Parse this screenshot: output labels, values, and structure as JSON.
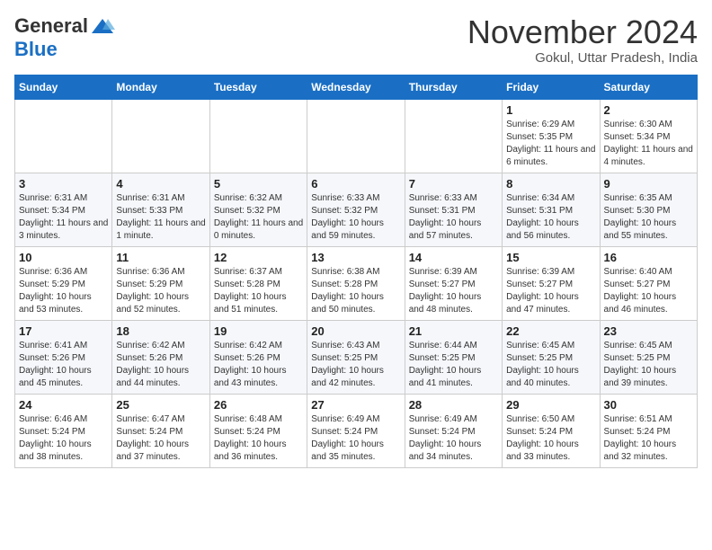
{
  "logo": {
    "line1": "General",
    "line2": "Blue"
  },
  "title": "November 2024",
  "location": "Gokul, Uttar Pradesh, India",
  "weekdays": [
    "Sunday",
    "Monday",
    "Tuesday",
    "Wednesday",
    "Thursday",
    "Friday",
    "Saturday"
  ],
  "weeks": [
    [
      {
        "day": "",
        "info": ""
      },
      {
        "day": "",
        "info": ""
      },
      {
        "day": "",
        "info": ""
      },
      {
        "day": "",
        "info": ""
      },
      {
        "day": "",
        "info": ""
      },
      {
        "day": "1",
        "info": "Sunrise: 6:29 AM\nSunset: 5:35 PM\nDaylight: 11 hours and 6 minutes."
      },
      {
        "day": "2",
        "info": "Sunrise: 6:30 AM\nSunset: 5:34 PM\nDaylight: 11 hours and 4 minutes."
      }
    ],
    [
      {
        "day": "3",
        "info": "Sunrise: 6:31 AM\nSunset: 5:34 PM\nDaylight: 11 hours and 3 minutes."
      },
      {
        "day": "4",
        "info": "Sunrise: 6:31 AM\nSunset: 5:33 PM\nDaylight: 11 hours and 1 minute."
      },
      {
        "day": "5",
        "info": "Sunrise: 6:32 AM\nSunset: 5:32 PM\nDaylight: 11 hours and 0 minutes."
      },
      {
        "day": "6",
        "info": "Sunrise: 6:33 AM\nSunset: 5:32 PM\nDaylight: 10 hours and 59 minutes."
      },
      {
        "day": "7",
        "info": "Sunrise: 6:33 AM\nSunset: 5:31 PM\nDaylight: 10 hours and 57 minutes."
      },
      {
        "day": "8",
        "info": "Sunrise: 6:34 AM\nSunset: 5:31 PM\nDaylight: 10 hours and 56 minutes."
      },
      {
        "day": "9",
        "info": "Sunrise: 6:35 AM\nSunset: 5:30 PM\nDaylight: 10 hours and 55 minutes."
      }
    ],
    [
      {
        "day": "10",
        "info": "Sunrise: 6:36 AM\nSunset: 5:29 PM\nDaylight: 10 hours and 53 minutes."
      },
      {
        "day": "11",
        "info": "Sunrise: 6:36 AM\nSunset: 5:29 PM\nDaylight: 10 hours and 52 minutes."
      },
      {
        "day": "12",
        "info": "Sunrise: 6:37 AM\nSunset: 5:28 PM\nDaylight: 10 hours and 51 minutes."
      },
      {
        "day": "13",
        "info": "Sunrise: 6:38 AM\nSunset: 5:28 PM\nDaylight: 10 hours and 50 minutes."
      },
      {
        "day": "14",
        "info": "Sunrise: 6:39 AM\nSunset: 5:27 PM\nDaylight: 10 hours and 48 minutes."
      },
      {
        "day": "15",
        "info": "Sunrise: 6:39 AM\nSunset: 5:27 PM\nDaylight: 10 hours and 47 minutes."
      },
      {
        "day": "16",
        "info": "Sunrise: 6:40 AM\nSunset: 5:27 PM\nDaylight: 10 hours and 46 minutes."
      }
    ],
    [
      {
        "day": "17",
        "info": "Sunrise: 6:41 AM\nSunset: 5:26 PM\nDaylight: 10 hours and 45 minutes."
      },
      {
        "day": "18",
        "info": "Sunrise: 6:42 AM\nSunset: 5:26 PM\nDaylight: 10 hours and 44 minutes."
      },
      {
        "day": "19",
        "info": "Sunrise: 6:42 AM\nSunset: 5:26 PM\nDaylight: 10 hours and 43 minutes."
      },
      {
        "day": "20",
        "info": "Sunrise: 6:43 AM\nSunset: 5:25 PM\nDaylight: 10 hours and 42 minutes."
      },
      {
        "day": "21",
        "info": "Sunrise: 6:44 AM\nSunset: 5:25 PM\nDaylight: 10 hours and 41 minutes."
      },
      {
        "day": "22",
        "info": "Sunrise: 6:45 AM\nSunset: 5:25 PM\nDaylight: 10 hours and 40 minutes."
      },
      {
        "day": "23",
        "info": "Sunrise: 6:45 AM\nSunset: 5:25 PM\nDaylight: 10 hours and 39 minutes."
      }
    ],
    [
      {
        "day": "24",
        "info": "Sunrise: 6:46 AM\nSunset: 5:24 PM\nDaylight: 10 hours and 38 minutes."
      },
      {
        "day": "25",
        "info": "Sunrise: 6:47 AM\nSunset: 5:24 PM\nDaylight: 10 hours and 37 minutes."
      },
      {
        "day": "26",
        "info": "Sunrise: 6:48 AM\nSunset: 5:24 PM\nDaylight: 10 hours and 36 minutes."
      },
      {
        "day": "27",
        "info": "Sunrise: 6:49 AM\nSunset: 5:24 PM\nDaylight: 10 hours and 35 minutes."
      },
      {
        "day": "28",
        "info": "Sunrise: 6:49 AM\nSunset: 5:24 PM\nDaylight: 10 hours and 34 minutes."
      },
      {
        "day": "29",
        "info": "Sunrise: 6:50 AM\nSunset: 5:24 PM\nDaylight: 10 hours and 33 minutes."
      },
      {
        "day": "30",
        "info": "Sunrise: 6:51 AM\nSunset: 5:24 PM\nDaylight: 10 hours and 32 minutes."
      }
    ]
  ]
}
